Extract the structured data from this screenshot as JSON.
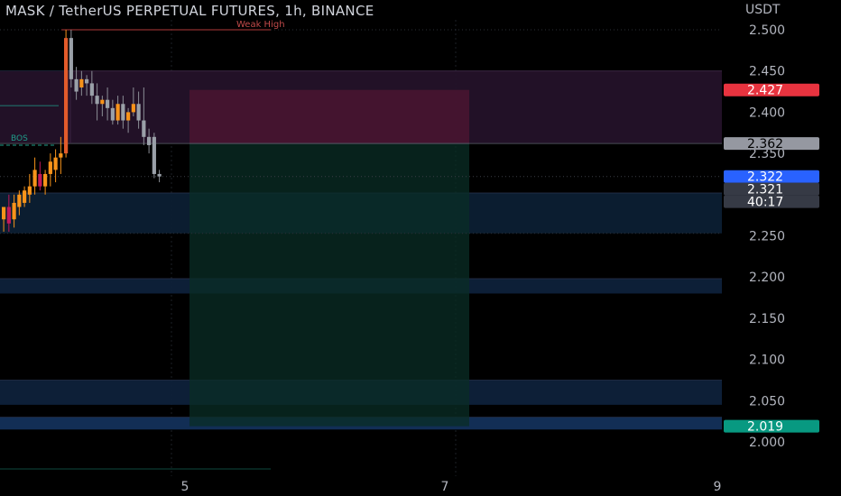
{
  "header": {
    "title": "MASK / TetherUS PERPETUAL FUTURES, 1h, BINANCE",
    "currency": "USDT"
  },
  "chart_data": {
    "type": "candlestick",
    "symbol": "MASK / TetherUS PERPETUAL FUTURES",
    "interval": "1h",
    "exchange": "BINANCE",
    "ylim": [
      1.99,
      2.52
    ],
    "y_ticks": [
      "2.500",
      "2.450",
      "2.400",
      "2.350",
      "2.300",
      "2.250",
      "2.200",
      "2.150",
      "2.100",
      "2.050",
      "2.000"
    ],
    "x_ticks": [
      "5",
      "7",
      "9"
    ],
    "candles": [
      {
        "o": 2.27,
        "h": 2.28,
        "l": 2.255,
        "c": 2.285
      },
      {
        "o": 2.285,
        "h": 2.3,
        "l": 2.255,
        "c": 2.265
      },
      {
        "o": 2.27,
        "h": 2.3,
        "l": 2.26,
        "c": 2.29
      },
      {
        "o": 2.285,
        "h": 2.305,
        "l": 2.275,
        "c": 2.3
      },
      {
        "o": 2.29,
        "h": 2.31,
        "l": 2.285,
        "c": 2.305
      },
      {
        "o": 2.3,
        "h": 2.325,
        "l": 2.29,
        "c": 2.31
      },
      {
        "o": 2.31,
        "h": 2.345,
        "l": 2.3,
        "c": 2.33
      },
      {
        "o": 2.325,
        "h": 2.34,
        "l": 2.305,
        "c": 2.31
      },
      {
        "o": 2.31,
        "h": 2.33,
        "l": 2.3,
        "c": 2.325
      },
      {
        "o": 2.325,
        "h": 2.35,
        "l": 2.31,
        "c": 2.34
      },
      {
        "o": 2.33,
        "h": 2.355,
        "l": 2.315,
        "c": 2.345
      },
      {
        "o": 2.345,
        "h": 2.37,
        "l": 2.325,
        "c": 2.35
      },
      {
        "o": 2.35,
        "h": 2.5,
        "l": 2.345,
        "c": 2.49
      },
      {
        "o": 2.49,
        "h": 2.5,
        "l": 2.43,
        "c": 2.44
      },
      {
        "o": 2.44,
        "h": 2.455,
        "l": 2.415,
        "c": 2.425
      },
      {
        "o": 2.43,
        "h": 2.45,
        "l": 2.42,
        "c": 2.44
      },
      {
        "o": 2.44,
        "h": 2.445,
        "l": 2.42,
        "c": 2.435
      },
      {
        "o": 2.435,
        "h": 2.45,
        "l": 2.41,
        "c": 2.42
      },
      {
        "o": 2.42,
        "h": 2.435,
        "l": 2.39,
        "c": 2.41
      },
      {
        "o": 2.41,
        "h": 2.42,
        "l": 2.395,
        "c": 2.415
      },
      {
        "o": 2.415,
        "h": 2.43,
        "l": 2.39,
        "c": 2.405
      },
      {
        "o": 2.405,
        "h": 2.415,
        "l": 2.385,
        "c": 2.39
      },
      {
        "o": 2.39,
        "h": 2.42,
        "l": 2.385,
        "c": 2.41
      },
      {
        "o": 2.41,
        "h": 2.42,
        "l": 2.38,
        "c": 2.39
      },
      {
        "o": 2.39,
        "h": 2.405,
        "l": 2.375,
        "c": 2.4
      },
      {
        "o": 2.4,
        "h": 2.43,
        "l": 2.395,
        "c": 2.41
      },
      {
        "o": 2.41,
        "h": 2.425,
        "l": 2.38,
        "c": 2.39
      },
      {
        "o": 2.39,
        "h": 2.43,
        "l": 2.36,
        "c": 2.37
      },
      {
        "o": 2.37,
        "h": 2.38,
        "l": 2.35,
        "c": 2.36
      },
      {
        "o": 2.37,
        "h": 2.375,
        "l": 2.32,
        "c": 2.325
      },
      {
        "o": 2.325,
        "h": 2.33,
        "l": 2.315,
        "c": 2.322
      }
    ],
    "zones": [
      {
        "top": 2.45,
        "bottom": 2.362,
        "color": "#241229"
      },
      {
        "top": 2.302,
        "bottom": 2.253,
        "color": "#0c1f33"
      },
      {
        "top": 2.198,
        "bottom": 2.18,
        "color": "#0e213a"
      },
      {
        "top": 2.075,
        "bottom": 2.045,
        "color": "#0e213a"
      },
      {
        "top": 2.03,
        "bottom": 2.015,
        "color": "#13305a"
      }
    ],
    "position": {
      "type": "short",
      "entry": 2.362,
      "stop": 2.427,
      "target": 2.019
    },
    "annotations": [
      {
        "text": "Weak High",
        "price": 2.5,
        "color": "#c24a4a"
      },
      {
        "text": "BOS",
        "price": 2.36,
        "color": "#1f9e8a"
      }
    ],
    "price_labels": [
      {
        "text": "2.427",
        "value": 2.427,
        "bg": "#e8333f",
        "fg": "#ffffff"
      },
      {
        "text": "2.362",
        "value": 2.362,
        "bg": "#9598a1",
        "fg": "#000000"
      },
      {
        "text": "2.322",
        "value": 2.322,
        "bg": "#2962ff",
        "fg": "#ffffff"
      },
      {
        "text": "2.321",
        "value": 2.321,
        "bg": "#363a45",
        "fg": "#ffffff"
      },
      {
        "text": "40:17",
        "value": null,
        "bg": "#363a45",
        "fg": "#ffffff"
      },
      {
        "text": "2.019",
        "value": 2.019,
        "bg": "#089981",
        "fg": "#ffffff"
      }
    ],
    "colors": {
      "up": "#f7931a",
      "down": "#c2185b",
      "axis_text": "#b2b5be",
      "stop_zone": "#4a1531",
      "target_zone": "#0a2d26"
    }
  }
}
